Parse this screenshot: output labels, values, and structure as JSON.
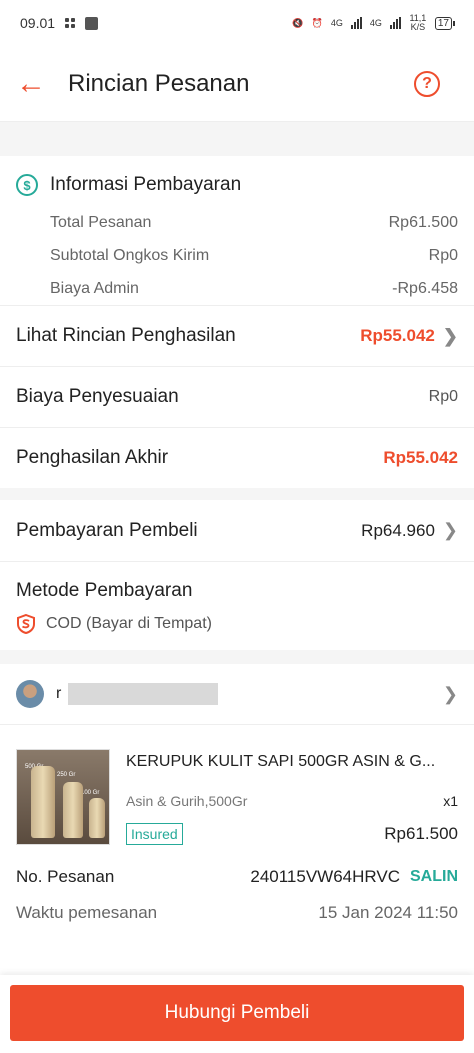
{
  "status_bar": {
    "time": "09.01",
    "battery": "17",
    "net_4g_1": "4G",
    "net_4g_2": "4G",
    "speed": "11,1 K/S"
  },
  "app_bar": {
    "title": "Rincian Pesanan"
  },
  "payment_info": {
    "title": "Informasi Pembayaran",
    "rows": [
      {
        "label": "Total Pesanan",
        "value": "Rp61.500"
      },
      {
        "label": "Subtotal Ongkos Kirim",
        "value": "Rp0"
      },
      {
        "label": "Biaya Admin",
        "value": "-Rp6.458"
      }
    ]
  },
  "income": {
    "detail_label": "Lihat Rincian Penghasilan",
    "detail_value": "Rp55.042",
    "adjust_label": "Biaya Penyesuaian",
    "adjust_value": "Rp0",
    "final_label": "Penghasilan Akhir",
    "final_value": "Rp55.042"
  },
  "buyer_payment": {
    "label": "Pembayaran Pembeli",
    "value": "Rp64.960",
    "method_title": "Metode Pembayaran",
    "method": "COD (Bayar di Tempat)"
  },
  "buyer": {
    "name_initial": "r"
  },
  "product": {
    "name": "KERUPUK KULIT SAPI 500GR ASIN & G...",
    "variant": "Asin & Gurih,500Gr",
    "qty": "x1",
    "badge": "Insured",
    "price": "Rp61.500",
    "thumb_labels": [
      "500 Gr",
      "250 Gr",
      "100 Gr"
    ]
  },
  "order": {
    "no_label": "No. Pesanan",
    "no_value": "240115VW64HRVC",
    "copy_label": "SALIN",
    "time_label": "Waktu pemesanan",
    "time_value": "15 Jan 2024 11:50"
  },
  "cta": {
    "label": "Hubungi Pembeli"
  },
  "colors": {
    "accent": "#ee4d2d",
    "teal": "#26aa99"
  }
}
